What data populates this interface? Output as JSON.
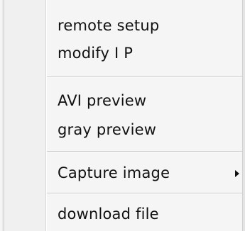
{
  "menu": {
    "groups": [
      {
        "items": [
          {
            "label": "remote setup"
          },
          {
            "label": "modify I P"
          }
        ]
      },
      {
        "items": [
          {
            "label": "AVI preview"
          },
          {
            "label": "gray preview"
          }
        ]
      },
      {
        "items": [
          {
            "label": "Capture image",
            "has_submenu": true,
            "submenu_icon": "chevron-right-icon"
          }
        ]
      },
      {
        "items": [
          {
            "label": "download file"
          }
        ]
      }
    ]
  }
}
